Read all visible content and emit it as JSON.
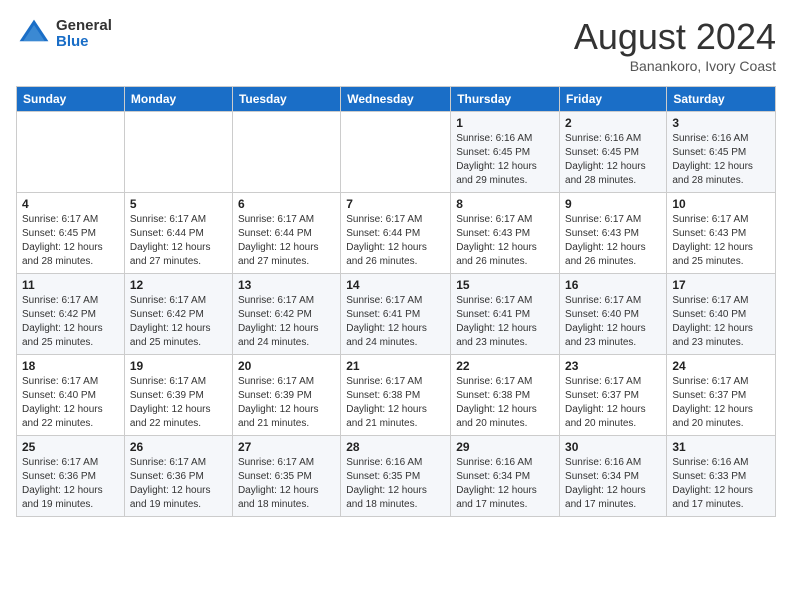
{
  "logo": {
    "general": "General",
    "blue": "Blue"
  },
  "header": {
    "month_year": "August 2024",
    "location": "Banankoro, Ivory Coast"
  },
  "days_of_week": [
    "Sunday",
    "Monday",
    "Tuesday",
    "Wednesday",
    "Thursday",
    "Friday",
    "Saturday"
  ],
  "weeks": [
    [
      {
        "day": "",
        "info": ""
      },
      {
        "day": "",
        "info": ""
      },
      {
        "day": "",
        "info": ""
      },
      {
        "day": "",
        "info": ""
      },
      {
        "day": "1",
        "info": "Sunrise: 6:16 AM\nSunset: 6:45 PM\nDaylight: 12 hours\nand 29 minutes."
      },
      {
        "day": "2",
        "info": "Sunrise: 6:16 AM\nSunset: 6:45 PM\nDaylight: 12 hours\nand 28 minutes."
      },
      {
        "day": "3",
        "info": "Sunrise: 6:16 AM\nSunset: 6:45 PM\nDaylight: 12 hours\nand 28 minutes."
      }
    ],
    [
      {
        "day": "4",
        "info": "Sunrise: 6:17 AM\nSunset: 6:45 PM\nDaylight: 12 hours\nand 28 minutes."
      },
      {
        "day": "5",
        "info": "Sunrise: 6:17 AM\nSunset: 6:44 PM\nDaylight: 12 hours\nand 27 minutes."
      },
      {
        "day": "6",
        "info": "Sunrise: 6:17 AM\nSunset: 6:44 PM\nDaylight: 12 hours\nand 27 minutes."
      },
      {
        "day": "7",
        "info": "Sunrise: 6:17 AM\nSunset: 6:44 PM\nDaylight: 12 hours\nand 26 minutes."
      },
      {
        "day": "8",
        "info": "Sunrise: 6:17 AM\nSunset: 6:43 PM\nDaylight: 12 hours\nand 26 minutes."
      },
      {
        "day": "9",
        "info": "Sunrise: 6:17 AM\nSunset: 6:43 PM\nDaylight: 12 hours\nand 26 minutes."
      },
      {
        "day": "10",
        "info": "Sunrise: 6:17 AM\nSunset: 6:43 PM\nDaylight: 12 hours\nand 25 minutes."
      }
    ],
    [
      {
        "day": "11",
        "info": "Sunrise: 6:17 AM\nSunset: 6:42 PM\nDaylight: 12 hours\nand 25 minutes."
      },
      {
        "day": "12",
        "info": "Sunrise: 6:17 AM\nSunset: 6:42 PM\nDaylight: 12 hours\nand 25 minutes."
      },
      {
        "day": "13",
        "info": "Sunrise: 6:17 AM\nSunset: 6:42 PM\nDaylight: 12 hours\nand 24 minutes."
      },
      {
        "day": "14",
        "info": "Sunrise: 6:17 AM\nSunset: 6:41 PM\nDaylight: 12 hours\nand 24 minutes."
      },
      {
        "day": "15",
        "info": "Sunrise: 6:17 AM\nSunset: 6:41 PM\nDaylight: 12 hours\nand 23 minutes."
      },
      {
        "day": "16",
        "info": "Sunrise: 6:17 AM\nSunset: 6:40 PM\nDaylight: 12 hours\nand 23 minutes."
      },
      {
        "day": "17",
        "info": "Sunrise: 6:17 AM\nSunset: 6:40 PM\nDaylight: 12 hours\nand 23 minutes."
      }
    ],
    [
      {
        "day": "18",
        "info": "Sunrise: 6:17 AM\nSunset: 6:40 PM\nDaylight: 12 hours\nand 22 minutes."
      },
      {
        "day": "19",
        "info": "Sunrise: 6:17 AM\nSunset: 6:39 PM\nDaylight: 12 hours\nand 22 minutes."
      },
      {
        "day": "20",
        "info": "Sunrise: 6:17 AM\nSunset: 6:39 PM\nDaylight: 12 hours\nand 21 minutes."
      },
      {
        "day": "21",
        "info": "Sunrise: 6:17 AM\nSunset: 6:38 PM\nDaylight: 12 hours\nand 21 minutes."
      },
      {
        "day": "22",
        "info": "Sunrise: 6:17 AM\nSunset: 6:38 PM\nDaylight: 12 hours\nand 20 minutes."
      },
      {
        "day": "23",
        "info": "Sunrise: 6:17 AM\nSunset: 6:37 PM\nDaylight: 12 hours\nand 20 minutes."
      },
      {
        "day": "24",
        "info": "Sunrise: 6:17 AM\nSunset: 6:37 PM\nDaylight: 12 hours\nand 20 minutes."
      }
    ],
    [
      {
        "day": "25",
        "info": "Sunrise: 6:17 AM\nSunset: 6:36 PM\nDaylight: 12 hours\nand 19 minutes."
      },
      {
        "day": "26",
        "info": "Sunrise: 6:17 AM\nSunset: 6:36 PM\nDaylight: 12 hours\nand 19 minutes."
      },
      {
        "day": "27",
        "info": "Sunrise: 6:17 AM\nSunset: 6:35 PM\nDaylight: 12 hours\nand 18 minutes."
      },
      {
        "day": "28",
        "info": "Sunrise: 6:16 AM\nSunset: 6:35 PM\nDaylight: 12 hours\nand 18 minutes."
      },
      {
        "day": "29",
        "info": "Sunrise: 6:16 AM\nSunset: 6:34 PM\nDaylight: 12 hours\nand 17 minutes."
      },
      {
        "day": "30",
        "info": "Sunrise: 6:16 AM\nSunset: 6:34 PM\nDaylight: 12 hours\nand 17 minutes."
      },
      {
        "day": "31",
        "info": "Sunrise: 6:16 AM\nSunset: 6:33 PM\nDaylight: 12 hours\nand 17 minutes."
      }
    ]
  ]
}
